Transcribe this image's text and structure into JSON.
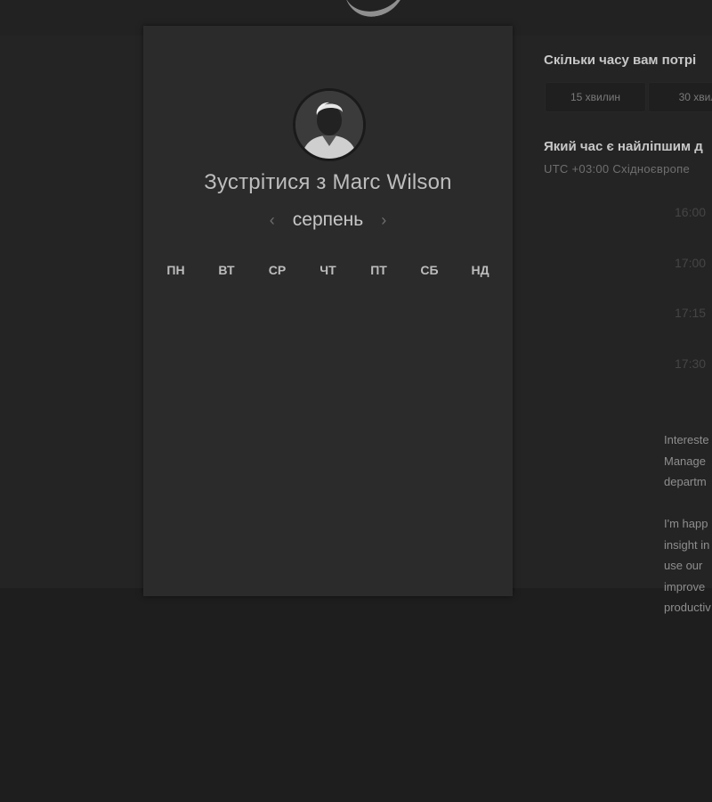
{
  "card": {
    "title": "Зустрітися з Marc Wilson",
    "month": "серпень",
    "prev_icon": "‹",
    "next_icon": "›",
    "weekdays": [
      "ПН",
      "ВТ",
      "СР",
      "ЧТ",
      "ПТ",
      "СБ",
      "НД"
    ]
  },
  "duration": {
    "question": "Скільки часу вам потрі",
    "options": [
      "15 хвилин",
      "30 хвил"
    ]
  },
  "time": {
    "question": "Який час є найліпшим д",
    "timezone": "UTC +03:00 Східноєвропе",
    "slots": [
      "16:00",
      "17:00",
      "17:15",
      "17:30"
    ]
  },
  "description": {
    "para1": [
      "Intereste",
      "Manage",
      "departm"
    ],
    "para2": [
      "I'm happ",
      "insight in",
      "use our",
      "improve",
      "productiv"
    ]
  },
  "colors": {
    "background": "#1e1e1e",
    "card": "#2b2b2b",
    "text": "#bdbdbd"
  }
}
